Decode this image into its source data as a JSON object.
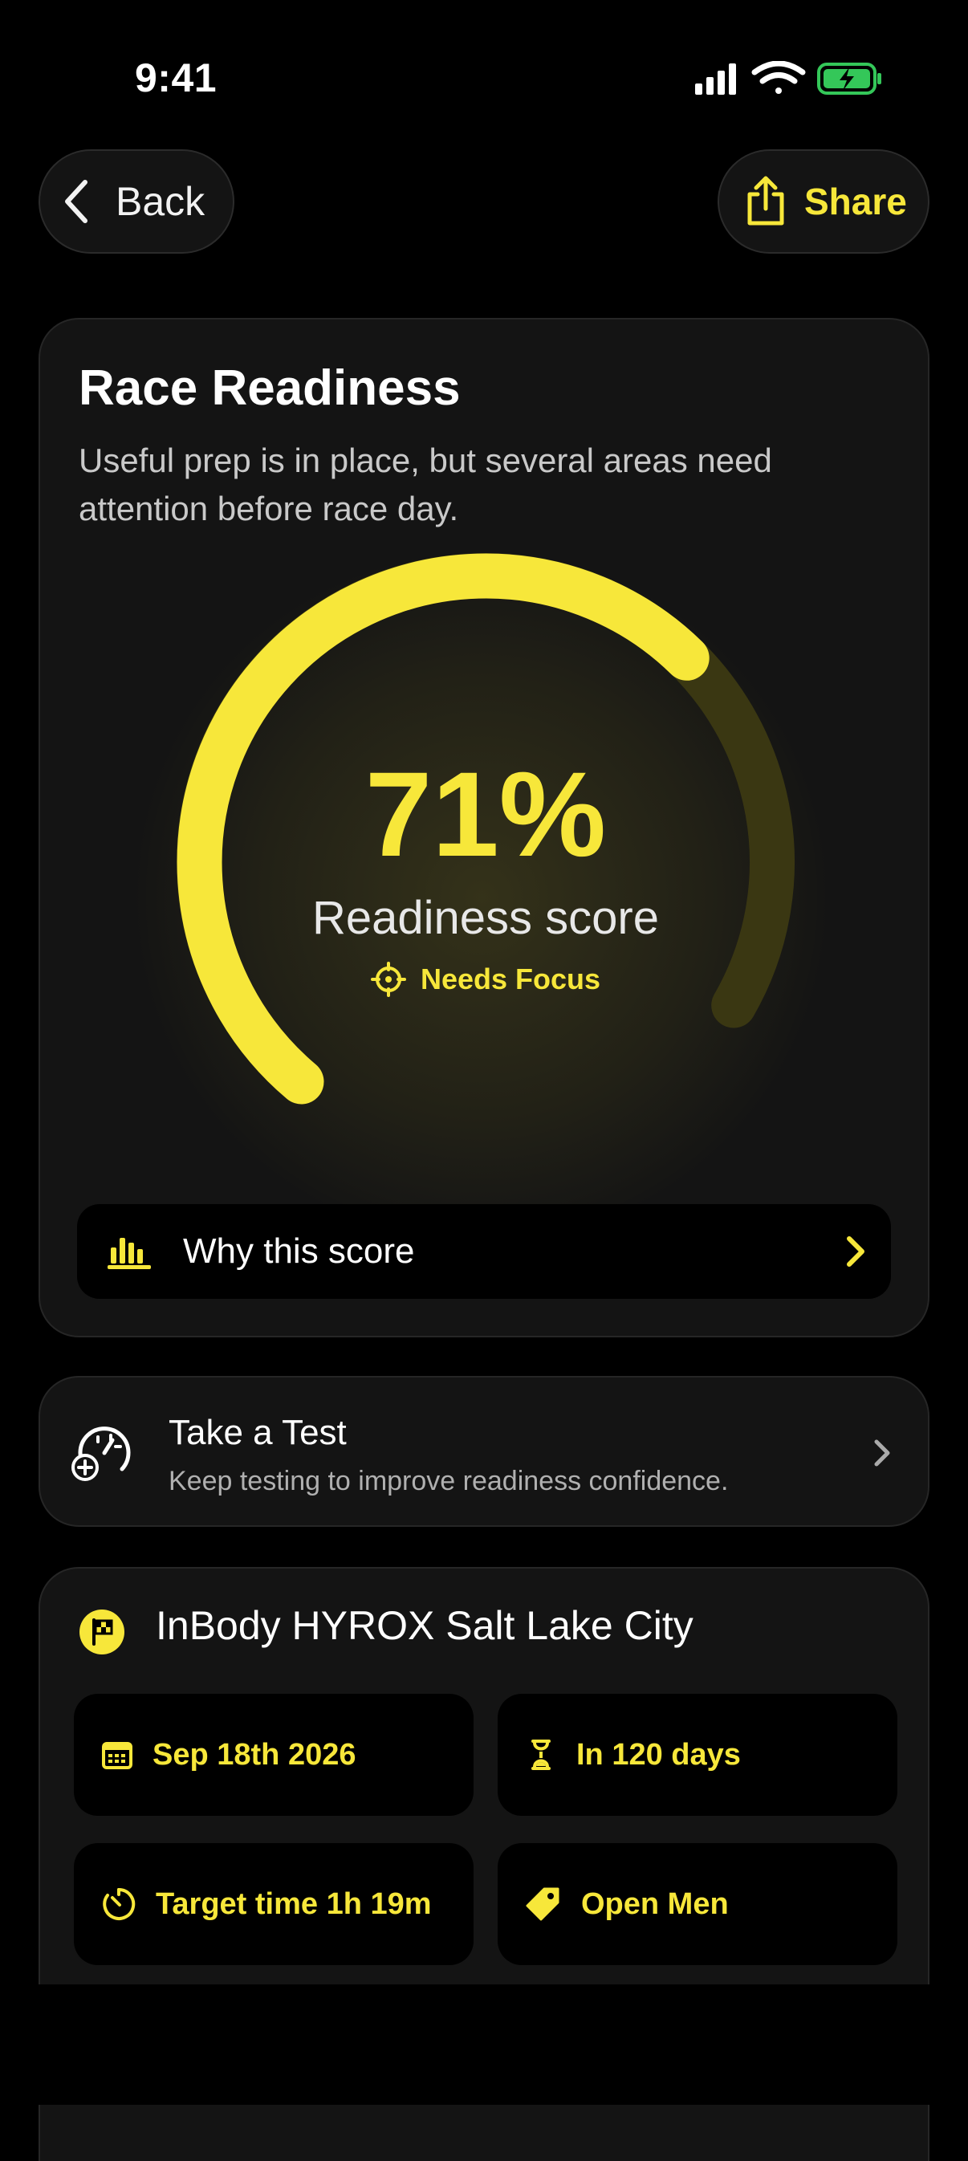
{
  "status_bar": {
    "time": "9:41",
    "icons": [
      "cellular-signal-icon",
      "wifi-icon",
      "battery-charging-icon"
    ]
  },
  "nav": {
    "back_label": "Back",
    "share_label": "Share",
    "icons": [
      "chevron-left-icon",
      "share-icon"
    ]
  },
  "readiness": {
    "title": "Race Readiness",
    "subtitle": "Useful prep is in place, but several areas need attention before race day.",
    "score_value": "71%",
    "score_fraction": 0.71,
    "score_label": "Readiness score",
    "status_label": "Needs Focus",
    "status_icon": "crosshair-icon",
    "why_label": "Why this score",
    "why_icon": "bar-chart-icon"
  },
  "test_card": {
    "title": "Take a Test",
    "subtitle": "Keep testing to improve readiness confidence.",
    "icon": "speedometer-plus-icon"
  },
  "event": {
    "title": "InBody HYROX Salt Lake City",
    "icon": "checkered-flag-icon",
    "date_label": "Sep 18th 2026",
    "countdown_label": "In 120 days",
    "target_label": "Target time 1h 19m",
    "division_label": "Open Men"
  },
  "colors": {
    "accent": "#f7e73a",
    "background": "#000000",
    "card": "#141414",
    "track": "#3a3712"
  }
}
